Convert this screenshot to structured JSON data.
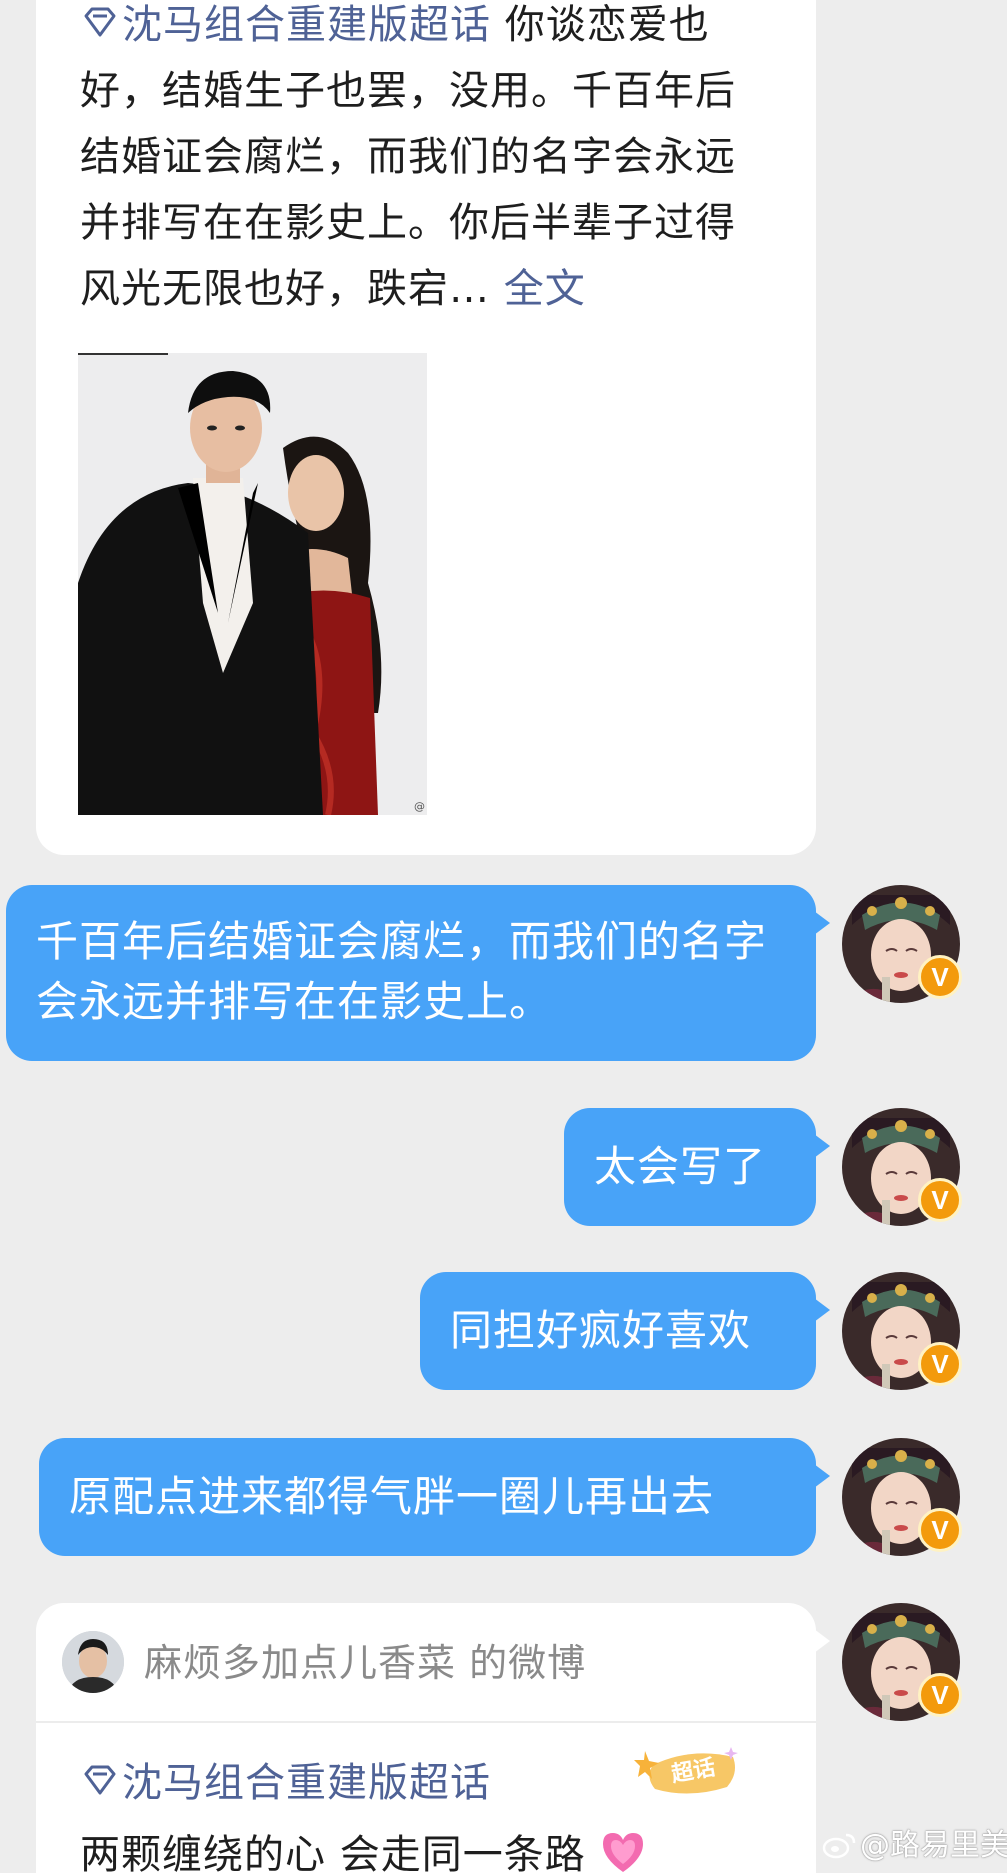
{
  "top_post": {
    "topic": "沈马组合重建版超话",
    "text": "你谈恋爱也好，结婚生子也罢，没用。千百年后结婚证会腐烂，而我们的名字会永远并排写在在影史上。你后半辈子过得风光无限也好，跌宕…",
    "more_label": "全文",
    "photo_watermark": "@"
  },
  "messages": [
    {
      "text": "千百年后结婚证会腐烂，而我们的名字会永远并排写在在影史上。",
      "badge": "V"
    },
    {
      "text": "太会写了",
      "badge": "V"
    },
    {
      "text": "同担好疯好喜欢",
      "badge": "V"
    },
    {
      "text": "原配点进来都得气胖一圈儿再出去",
      "badge": "V"
    }
  ],
  "bottom_post": {
    "author": "麻烦多加点儿香菜",
    "author_suffix": "的微博",
    "topic": "沈马组合重建版超话",
    "badge_label": "超话",
    "text": "两颗缠绕的心 会走同一条路",
    "badge": "V"
  },
  "watermark": "@路易里美",
  "colors": {
    "bubble": "#48a3f8",
    "link": "#4f6296",
    "background": "#ededed",
    "verified_badge": "#f39a0c"
  }
}
